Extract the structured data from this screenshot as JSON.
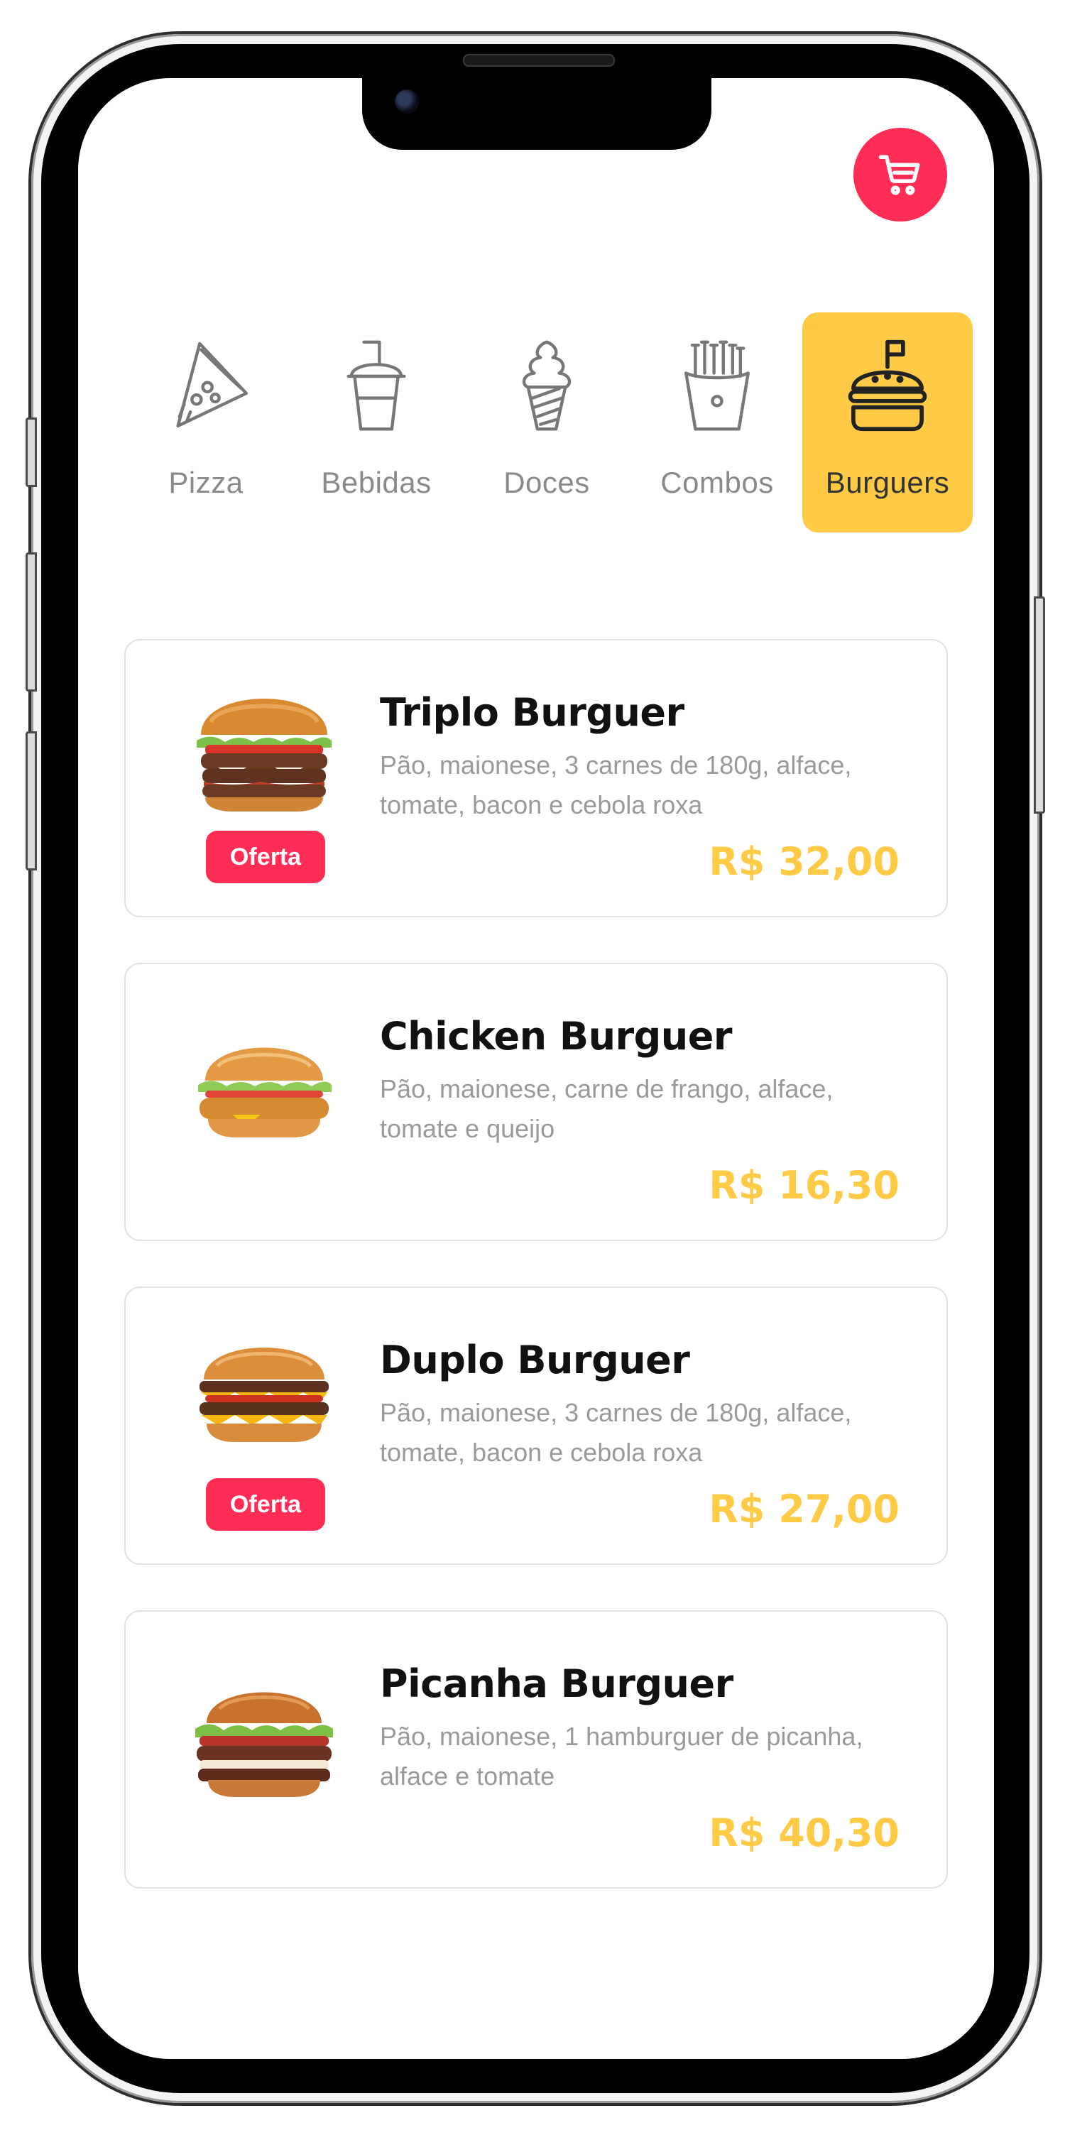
{
  "colors": {
    "accent": "#ff2d55",
    "highlight": "#ffcb47",
    "price": "#ffcb47",
    "muted_text": "#9a9a9a"
  },
  "header": {
    "cart_icon": "shopping-cart-icon"
  },
  "categories": [
    {
      "label": "Pizza",
      "icon": "pizza-slice-icon",
      "active": false
    },
    {
      "label": "Bebidas",
      "icon": "drink-cup-icon",
      "active": false
    },
    {
      "label": "Doces",
      "icon": "ice-cream-icon",
      "active": false
    },
    {
      "label": "Combos",
      "icon": "fries-icon",
      "active": false
    },
    {
      "label": "Burguers",
      "icon": "burger-icon",
      "active": true
    }
  ],
  "products": [
    {
      "name": "Triplo Burguer",
      "description": "Pão, maionese, 3 carnes de 180g, alface, tomate, bacon e cebola roxa",
      "price": "R$ 32,00",
      "badge": "Oferta",
      "image": "triple-burger-image"
    },
    {
      "name": "Chicken Burguer",
      "description": "Pão, maionese, carne de frango, alface, tomate e queijo",
      "price": "R$ 16,30",
      "badge": null,
      "image": "chicken-burger-image"
    },
    {
      "name": "Duplo Burguer",
      "description": "Pão, maionese, 3 carnes de 180g, alface, tomate, bacon e cebola roxa",
      "price": "R$ 27,00",
      "badge": "Oferta",
      "image": "double-burger-image"
    },
    {
      "name": "Picanha Burguer",
      "description": "Pão, maionese, 1 hamburguer de picanha, alface e tomate",
      "price": "R$ 40,30",
      "badge": null,
      "image": "picanha-burger-image"
    }
  ]
}
